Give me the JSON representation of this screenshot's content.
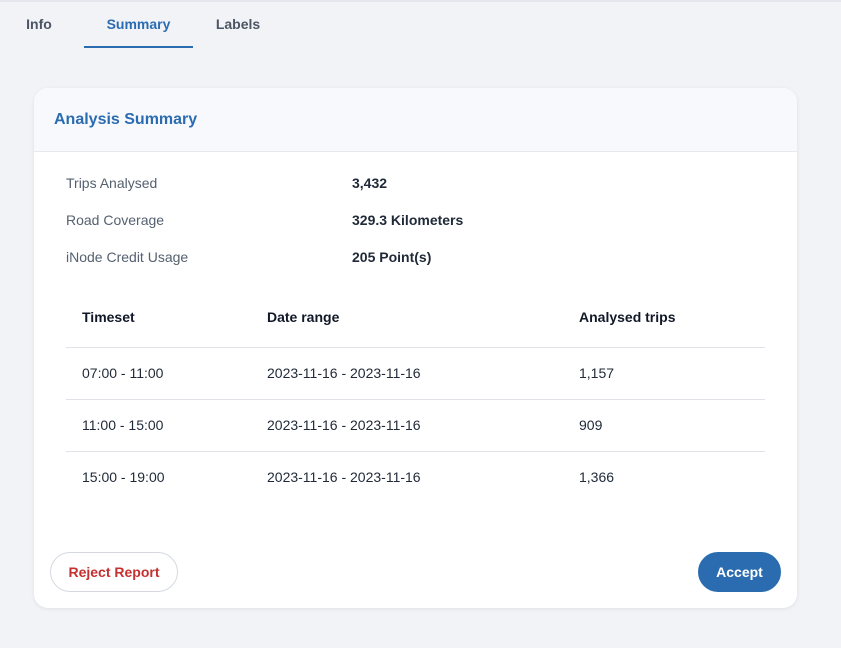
{
  "tabs": [
    {
      "label": "Info",
      "active": false
    },
    {
      "label": "Summary",
      "active": true
    },
    {
      "label": "Labels",
      "active": false
    }
  ],
  "card": {
    "title": "Analysis Summary",
    "stats": [
      {
        "label": "Trips Analysed",
        "value": "3,432"
      },
      {
        "label": "Road Coverage",
        "value": "329.3 Kilometers"
      },
      {
        "label": "iNode Credit Usage",
        "value": "205 Point(s)"
      }
    ],
    "table": {
      "headers": [
        "Timeset",
        "Date range",
        "Analysed trips"
      ],
      "rows": [
        [
          "07:00 - 11:00",
          "2023-11-16 - 2023-11-16",
          "1,157"
        ],
        [
          "11:00 - 15:00",
          "2023-11-16 - 2023-11-16",
          "909"
        ],
        [
          "15:00 - 19:00",
          "2023-11-16 - 2023-11-16",
          "1,366"
        ]
      ]
    },
    "actions": {
      "reject_label": "Reject Report",
      "accept_label": "Accept"
    }
  },
  "colors": {
    "accent": "#2b6cb0",
    "danger": "#c53030",
    "background": "#f1f3f7"
  }
}
